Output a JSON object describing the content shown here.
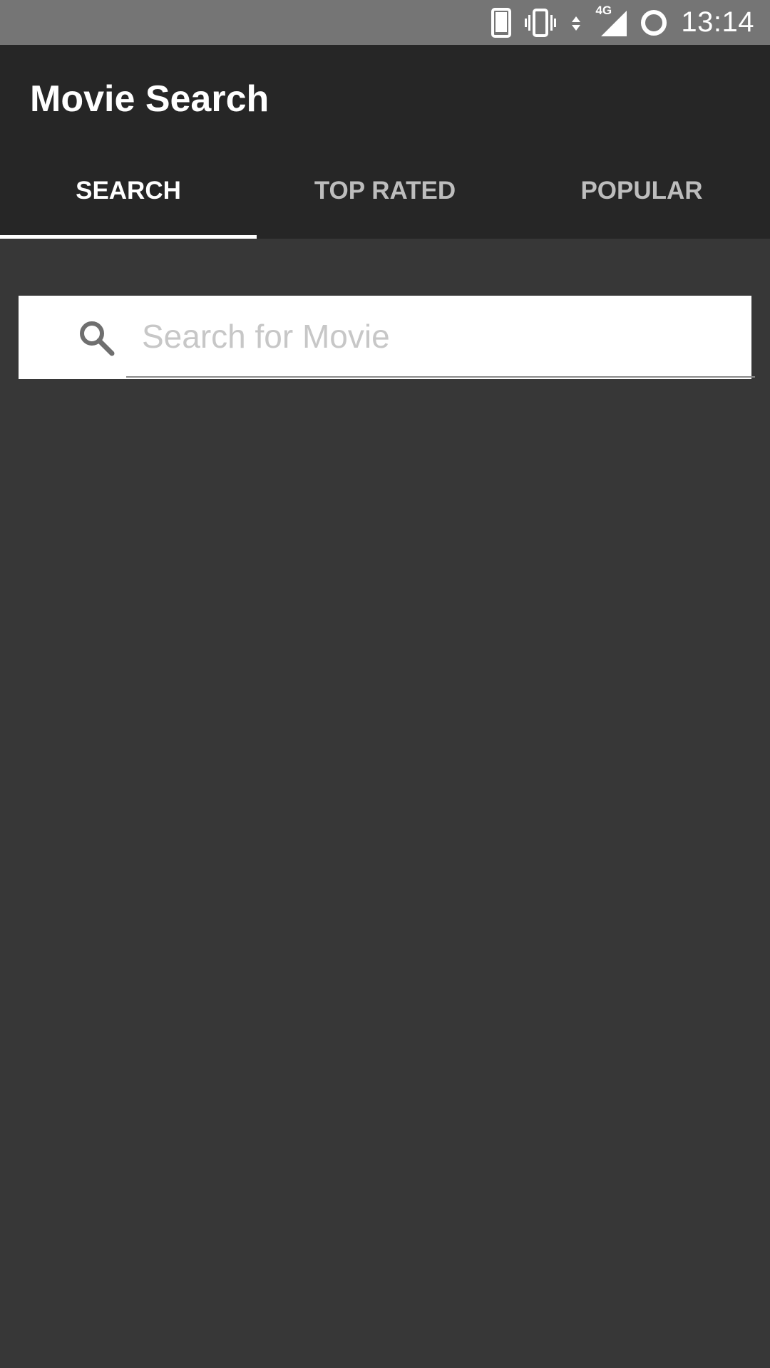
{
  "status_bar": {
    "time": "13:14",
    "network_label": "4G",
    "icons": [
      "phone-icon",
      "vibrate-icon",
      "data-arrows-icon",
      "signal-icon",
      "sync-icon"
    ],
    "background_color": "#757575"
  },
  "app_bar": {
    "title": "Movie Search",
    "background_color": "#262626"
  },
  "tabs": [
    {
      "label": "SEARCH",
      "active": true
    },
    {
      "label": "TOP RATED",
      "active": false
    },
    {
      "label": "POPULAR",
      "active": false
    }
  ],
  "search": {
    "placeholder": "Search for Movie",
    "value": "",
    "icon": "search-icon"
  },
  "colors": {
    "content_background": "#373737",
    "active_tab_text": "#ffffff",
    "inactive_tab_text": "#bdbdbd",
    "placeholder": "#c7c7c7"
  }
}
